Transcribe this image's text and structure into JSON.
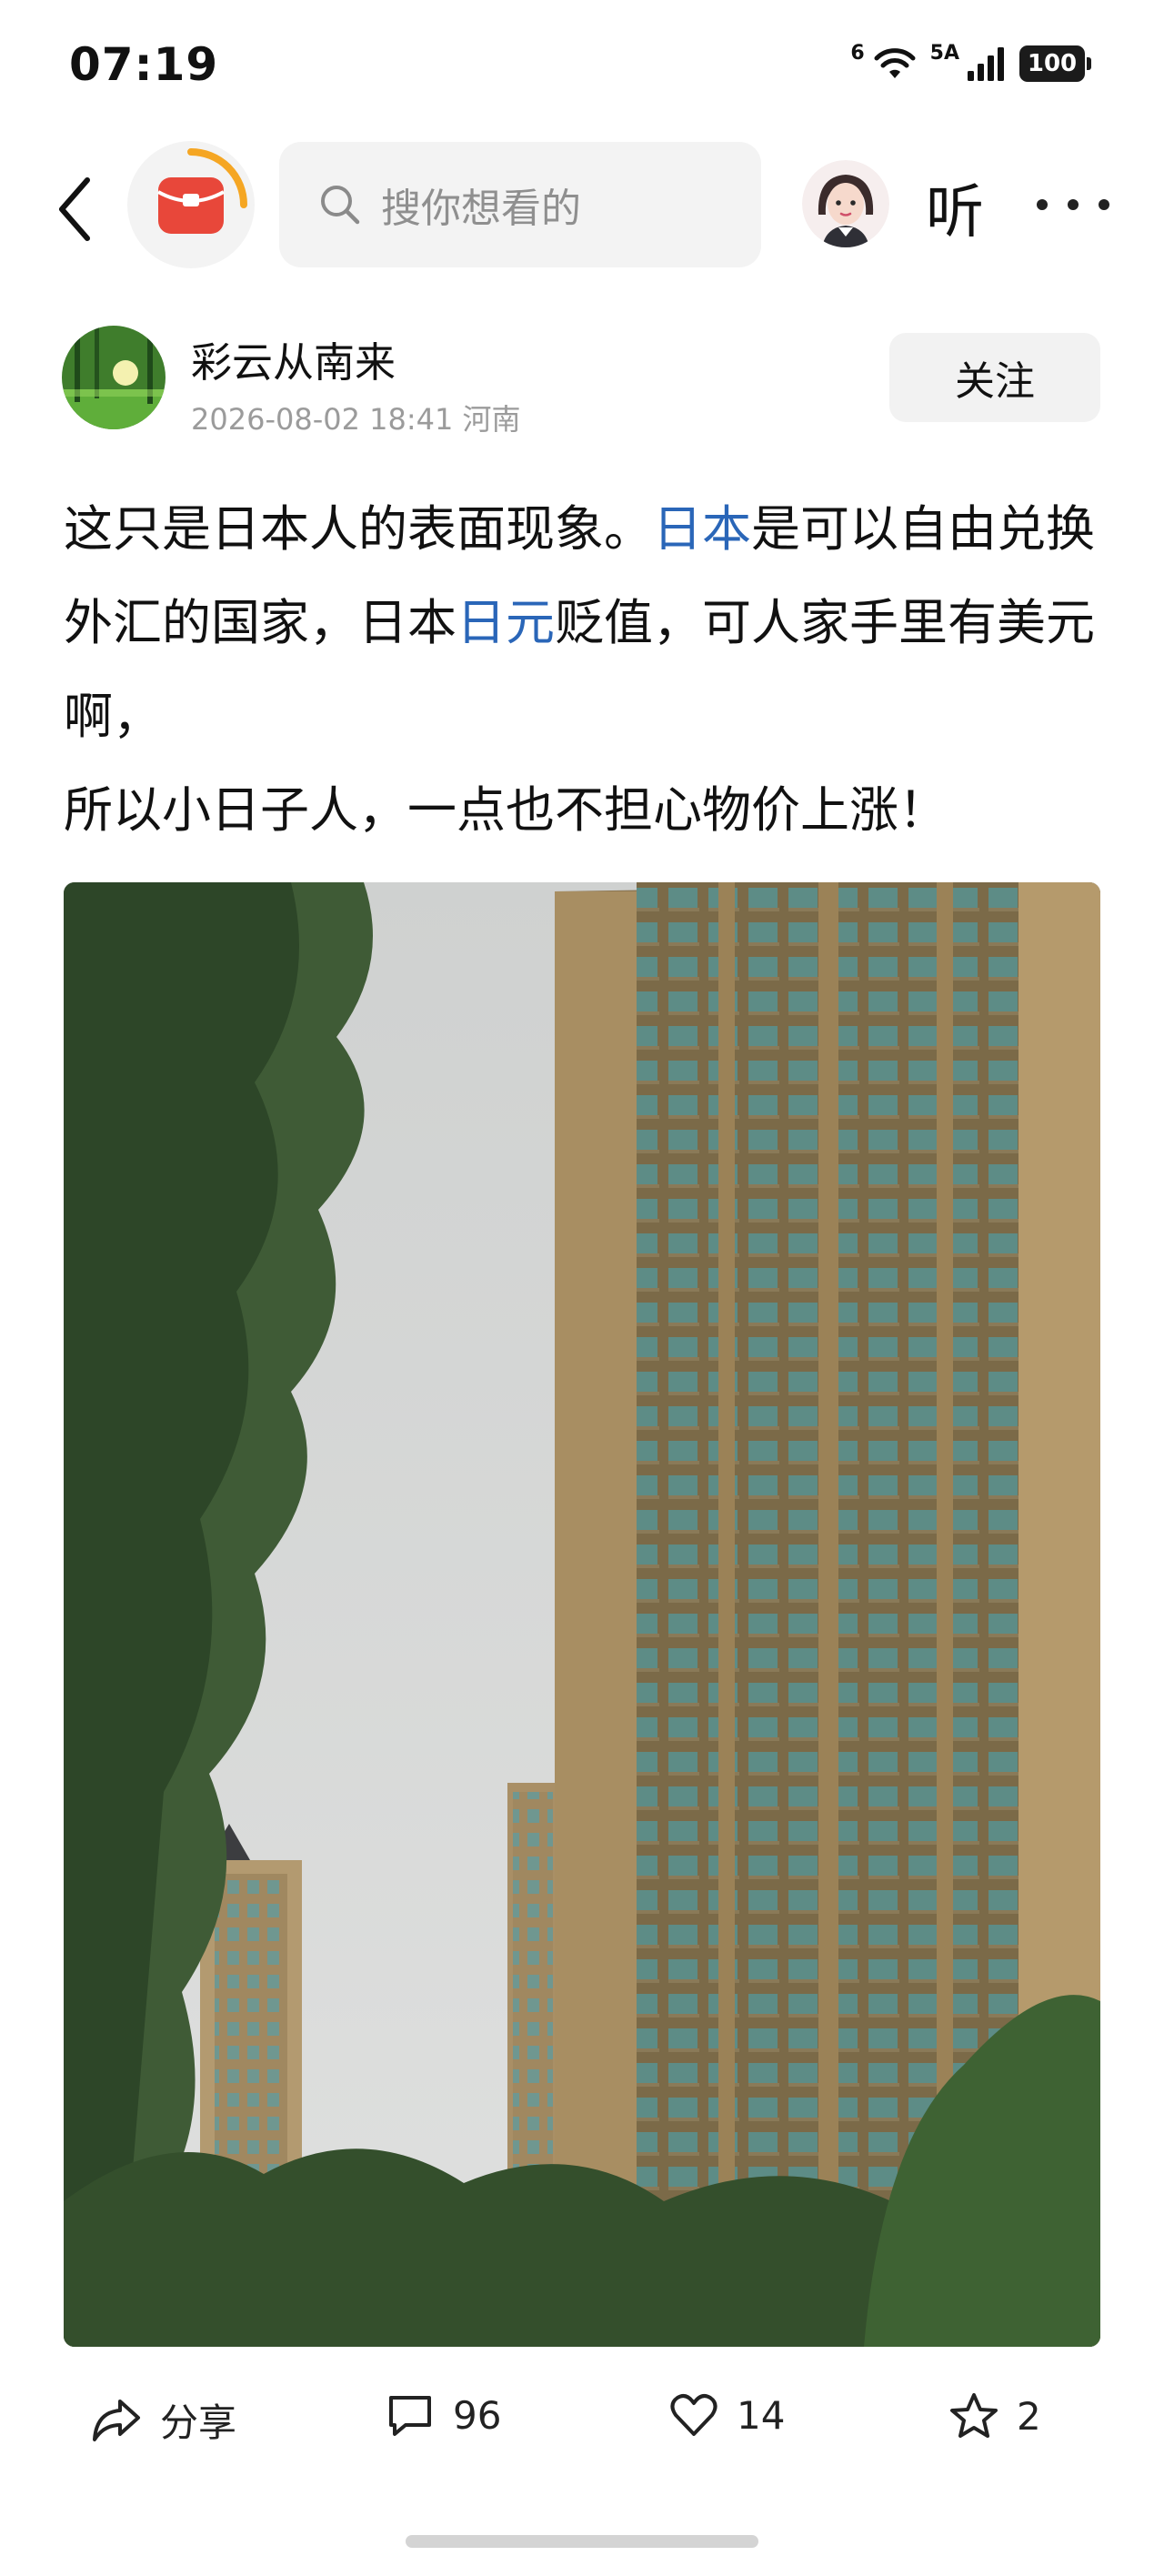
{
  "status_bar": {
    "time": "07:19",
    "network_a": "6",
    "network_b": "5A",
    "battery": "100",
    "icons": [
      "wifi-icon",
      "cell-signal-icon",
      "battery-icon"
    ]
  },
  "nav": {
    "search_placeholder": "搜你想看的",
    "listen_label": "听",
    "icons": [
      "back-arrow-icon",
      "red-envelope-icon",
      "search-icon",
      "avatar",
      "more-icon"
    ]
  },
  "post": {
    "author": "彩云从南来",
    "date": "2026-08-02 18:41",
    "location": "河南",
    "follow_label": "关注",
    "text_segments": [
      "这只是日本人的表面现象。",
      "日本",
      "是可以自由兑换外汇的国家，日本",
      "日元",
      "贬值，可人家手里有美元啊，",
      "所以小日子人，一点也不担心物价上涨！"
    ]
  },
  "actions": {
    "share_label": "分享",
    "comments": "96",
    "likes": "14",
    "favorites": "2"
  },
  "colors": {
    "link": "#2a66b8",
    "accent_red": "#e8473a",
    "accent_orange": "#f5a623"
  }
}
